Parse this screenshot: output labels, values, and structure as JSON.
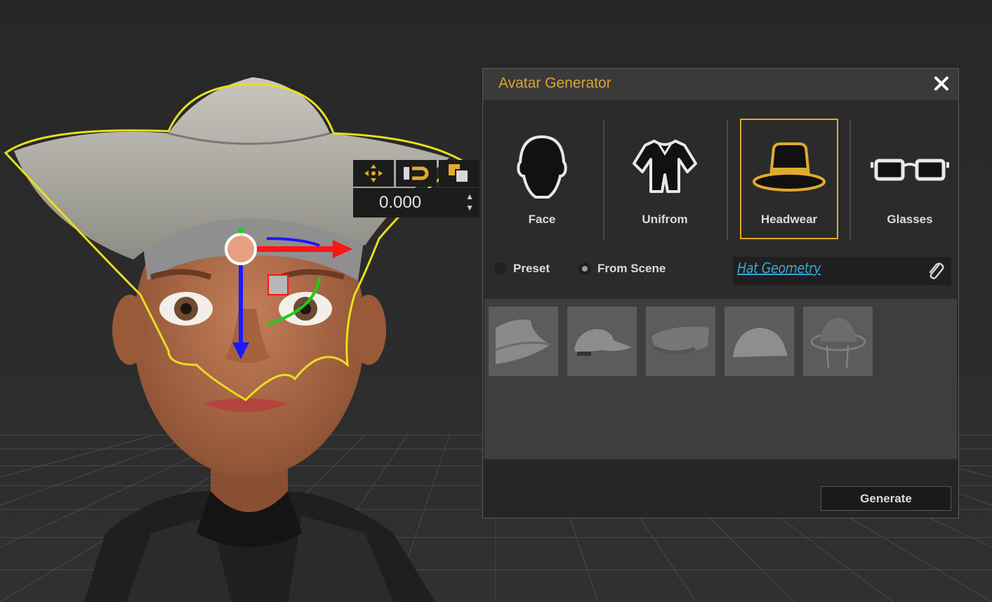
{
  "window": {
    "title": "Avatar Generator"
  },
  "toolbar": {
    "value": "0.000"
  },
  "categories": [
    {
      "label": "Face",
      "icon": "head-silhouette-icon"
    },
    {
      "label": "Unifrom",
      "icon": "uniform-icon"
    },
    {
      "label": "Headwear",
      "icon": "hat-icon",
      "selected": true
    },
    {
      "label": "Glasses",
      "icon": "glasses-icon"
    }
  ],
  "source": {
    "preset_label": "Preset",
    "scene_label": "From Scene",
    "selected": "From Scene",
    "geometry_value": "Hat Geometry"
  },
  "presets": [
    {
      "icon": "bucket-hat-icon"
    },
    {
      "icon": "baseball-cap-icon"
    },
    {
      "icon": "peaked-cap-icon"
    },
    {
      "icon": "beanie-cap-icon"
    },
    {
      "icon": "helmet-icon"
    }
  ],
  "actions": {
    "generate_label": "Generate"
  },
  "colors": {
    "accent": "#d8a631",
    "selection_outline": "#e8e01a",
    "link": "#3aa7d4"
  }
}
